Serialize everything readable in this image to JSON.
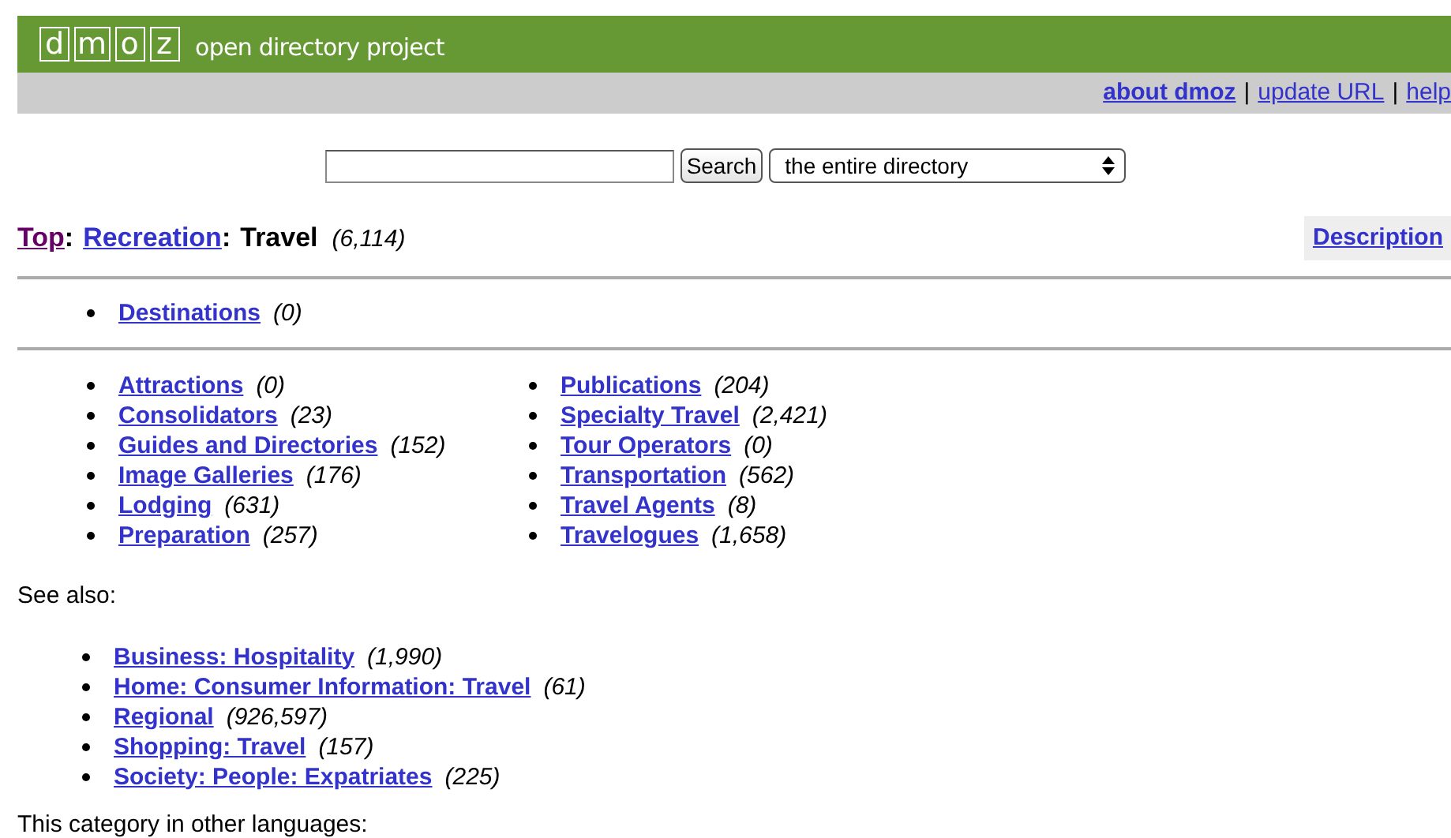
{
  "header": {
    "logo_letters": [
      "d",
      "m",
      "o",
      "z"
    ],
    "tagline": "open directory project"
  },
  "top_links_separator": "|",
  "top_links": [
    {
      "label": "about dmoz",
      "bold": true
    },
    {
      "label": "update URL",
      "bold": false
    },
    {
      "label": "help",
      "bold": false
    }
  ],
  "search": {
    "button": "Search",
    "scope": "the entire directory"
  },
  "breadcrumb": {
    "separator": ":",
    "links": [
      {
        "label": "Top",
        "visited": true
      },
      {
        "label": "Recreation",
        "visited": false
      }
    ],
    "current": "Travel",
    "count": "(6,114)"
  },
  "description_link": "Description",
  "featured": [
    {
      "label": "Destinations",
      "count": "(0)"
    }
  ],
  "categories": {
    "column_1": [
      {
        "label": "Attractions",
        "count": "(0)"
      },
      {
        "label": "Consolidators",
        "count": "(23)"
      },
      {
        "label": "Guides and Directories",
        "count": "(152)"
      },
      {
        "label": "Image Galleries",
        "count": "(176)"
      },
      {
        "label": "Lodging",
        "count": "(631)"
      },
      {
        "label": "Preparation",
        "count": "(257)"
      }
    ],
    "column_2": [
      {
        "label": "Publications",
        "count": "(204)"
      },
      {
        "label": "Specialty Travel",
        "count": "(2,421)"
      },
      {
        "label": "Tour Operators",
        "count": "(0)"
      },
      {
        "label": "Transportation",
        "count": "(562)"
      },
      {
        "label": "Travel Agents",
        "count": "(8)"
      },
      {
        "label": "Travelogues",
        "count": "(1,658)"
      }
    ]
  },
  "see_also": {
    "heading": "See also:",
    "items": [
      {
        "label": "Business: Hospitality",
        "count": "(1,990)"
      },
      {
        "label": "Home: Consumer Information: Travel",
        "count": "(61)"
      },
      {
        "label": "Regional",
        "count": "(926,597)"
      },
      {
        "label": "Shopping: Travel",
        "count": "(157)"
      },
      {
        "label": "Society: People: Expatriates",
        "count": "(225)"
      }
    ]
  },
  "other_languages": "This category in other languages:"
}
